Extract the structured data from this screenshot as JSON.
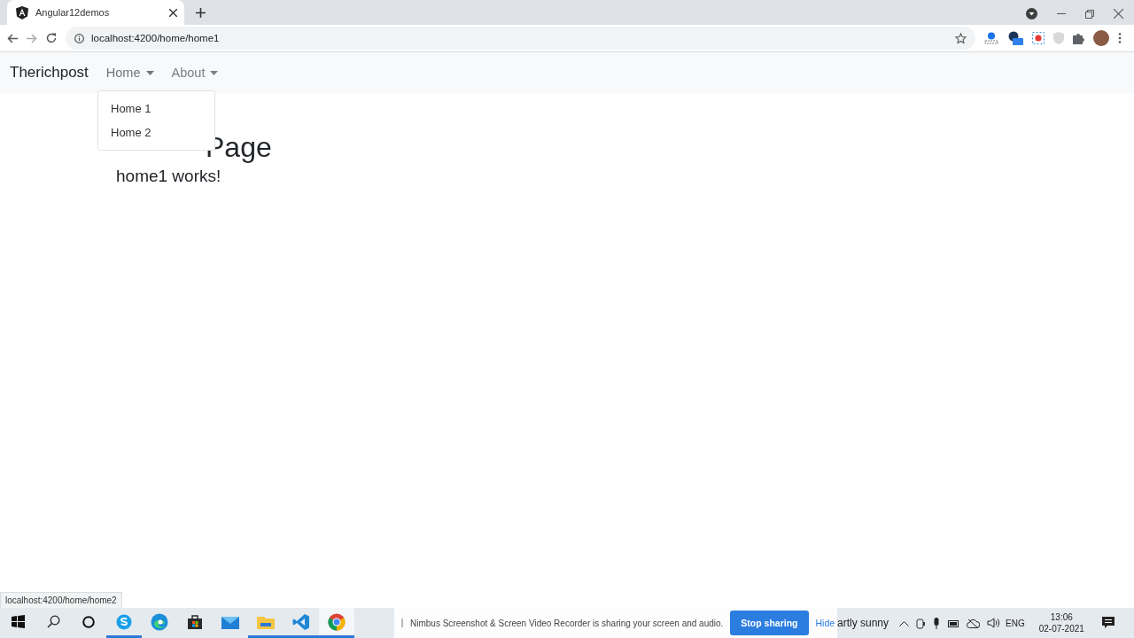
{
  "browser": {
    "tab_title": "Angular12demos",
    "url": "localhost:4200/home/home1",
    "status_link": "localhost:4200/home/home2"
  },
  "navbar": {
    "brand": "Therichpost",
    "menus": [
      {
        "label": "Home",
        "expanded": true
      },
      {
        "label": "About",
        "expanded": false
      }
    ],
    "dropdown": [
      "Home 1",
      "Home 2"
    ]
  },
  "page": {
    "heading": "Page",
    "subheading": "home1 works!"
  },
  "taskbar": {
    "apps": [
      {
        "kind": "skype",
        "running": true,
        "selected": false
      },
      {
        "kind": "edge",
        "running": false,
        "selected": false
      },
      {
        "kind": "store",
        "running": false,
        "selected": false
      },
      {
        "kind": "mail",
        "running": false,
        "selected": false
      },
      {
        "kind": "files",
        "running": true,
        "selected": false
      },
      {
        "kind": "vscode",
        "running": true,
        "selected": false
      },
      {
        "kind": "chrome",
        "running": true,
        "selected": true
      }
    ],
    "sharing": {
      "message": "Nimbus Screenshot & Screen Video Recorder is sharing your screen and audio.",
      "stop": "Stop sharing",
      "hide": "Hide"
    },
    "weather": "artly sunny",
    "language": "ENG",
    "time": "13:06",
    "date": "02-07-2021"
  }
}
